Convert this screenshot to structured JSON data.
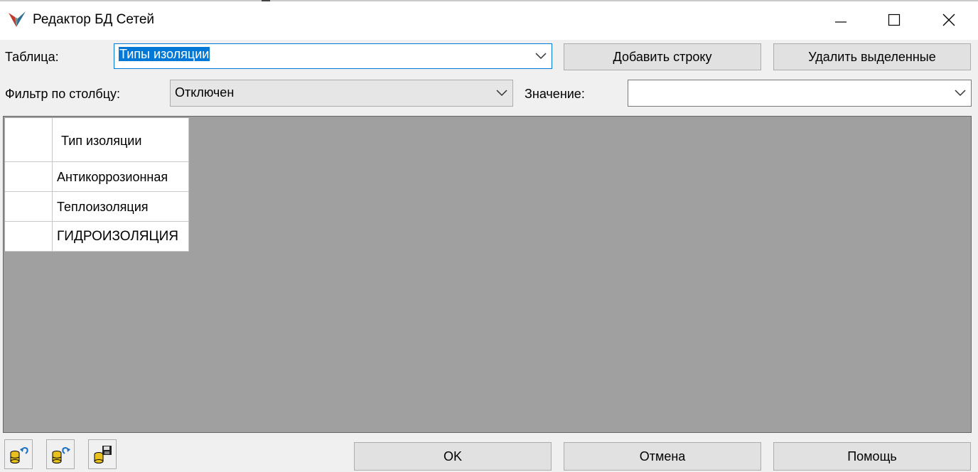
{
  "window": {
    "title": "Редактор БД Сетей",
    "minimize_glyph": "—",
    "maximize_glyph": "☐",
    "close_glyph": "✕"
  },
  "table_row": {
    "label": "Таблица:",
    "selected": "Типы изоляции",
    "add_row_label": "Добавить строку",
    "delete_selected_label": "Удалить выделенные"
  },
  "filter_row": {
    "label": "Фильтр по столбцу:",
    "selected": "Отключен",
    "value_label": "Значение:",
    "value": ""
  },
  "grid": {
    "columns": [
      "Тип изоляции"
    ],
    "rows": [
      [
        "Антикоррозионная"
      ],
      [
        "Теплоизоляция"
      ],
      [
        "ГИДРОИЗОЛЯЦИЯ"
      ]
    ]
  },
  "footer": {
    "tools": [
      "db-undo-icon",
      "db-redo-icon",
      "db-save-icon"
    ],
    "ok_label": "OK",
    "cancel_label": "Отмена",
    "help_label": "Помощь"
  },
  "colors": {
    "accent": "#0078d7",
    "grid_background": "#a0a0a0",
    "button_face": "#e1e1e1",
    "db_yellow": "#e8c020"
  }
}
